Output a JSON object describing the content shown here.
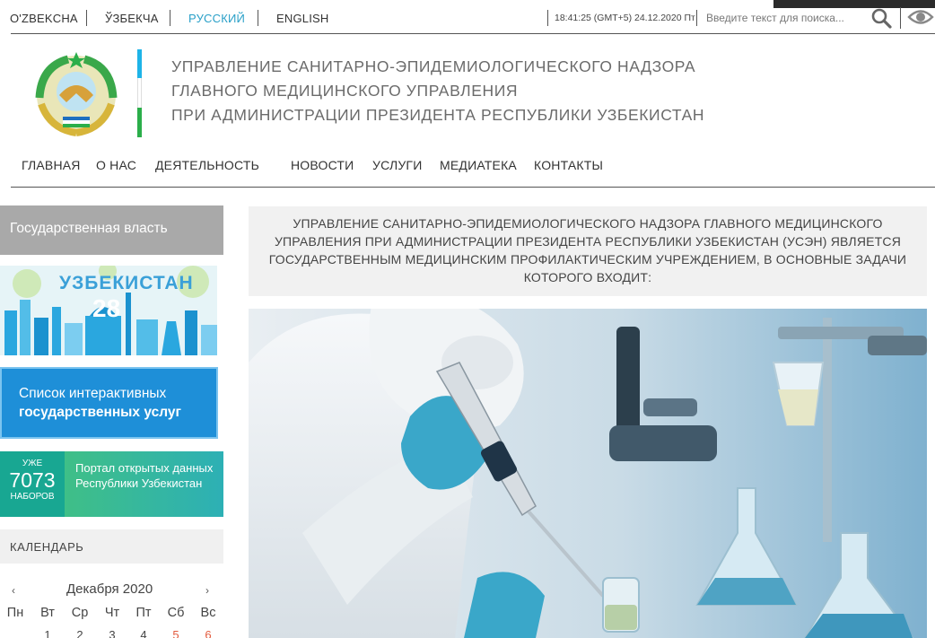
{
  "top_bar": {
    "languages": [
      {
        "label": "O'ZBEKCHA",
        "active": false
      },
      {
        "label": "ЎЗБЕКЧА",
        "active": false
      },
      {
        "label": "РУССКИЙ",
        "active": true
      },
      {
        "label": "ENGLISH",
        "active": false
      }
    ],
    "datetime": "18:41:25 (GMT+5) 24.12.2020 Пт",
    "search_placeholder": "Введите текст для поиска...",
    "search_icon": "magnifier-icon",
    "accessibility_icon": "eye-icon"
  },
  "header": {
    "title_lines": [
      "УПРАВЛЕНИЕ САНИТАРНО-ЭПИДЕМИОЛОГИЧЕСКОГО НАДЗОРА",
      "ГЛАВНОГО МЕДИЦИНСКОГО УПРАВЛЕНИЯ",
      "ПРИ АДМИНИСТРАЦИИ ПРЕЗИДЕНТА РЕСПУБЛИКИ УЗБЕКИСТАН"
    ],
    "emblem_icon": "state-emblem-icon",
    "flag_colors": [
      "#1eb4e8",
      "#ffffff",
      "#2bae4a"
    ]
  },
  "nav": {
    "items": [
      "ГЛАВНАЯ",
      "О НАС",
      "ДЕЯТЕЛЬНОСТЬ",
      "НОВОСТИ",
      "УСЛУГИ",
      "МЕДИАТЕКА",
      "КОНТАКТЫ"
    ]
  },
  "sidebar": {
    "gov_power_label": "Государственная власть",
    "banner_uz": {
      "title": "УЗБЕКИСТАН",
      "number": "28"
    },
    "services_banner": {
      "line1": "Список интерактивных",
      "line2": "государственных услуг"
    },
    "portal_banner": {
      "count_prefix": "УЖЕ",
      "count": "7073",
      "count_suffix": "НАБОРОВ",
      "text": "Портал открытых данных Республики Узбекистан"
    },
    "calendar": {
      "heading": "КАЛЕНДАРЬ",
      "month": "Декабря 2020",
      "prev": "‹",
      "next": "›",
      "weekdays": [
        "Пн",
        "Вт",
        "Ср",
        "Чт",
        "Пт",
        "Сб",
        "Вс"
      ],
      "first_row": [
        "",
        "1",
        "2",
        "3",
        "4",
        "5",
        "6"
      ]
    }
  },
  "main": {
    "intro_text": "УПРАВЛЕНИЕ САНИТАРНО-ЭПИДЕМИОЛОГИЧЕСКОГО НАДЗОРА ГЛАВНОГО МЕДИЦИНСКОГО УПРАВЛЕНИЯ ПРИ АДМИНИСТРАЦИИ ПРЕЗИДЕНТА РЕСПУБЛИКИ УЗБЕКИСТАН (УСЭН) ЯВЛЯЕТСЯ ГОСУДАРСТВЕННЫМ МЕДИЦИНСКИМ ПРОФИЛАКТИЧЕСКИМ УЧРЕЖДЕНИЕМ, В ОСНОВНЫЕ ЗАДАЧИ КОТОРОГО ВХОДИТ:"
  },
  "colors": {
    "accent": "#2aa0c8",
    "gov_power_bg": "#a9a9a9",
    "services_bg": "#1e8fd8",
    "portal_bg": "#18a792",
    "weekend": "#e35a3d"
  }
}
